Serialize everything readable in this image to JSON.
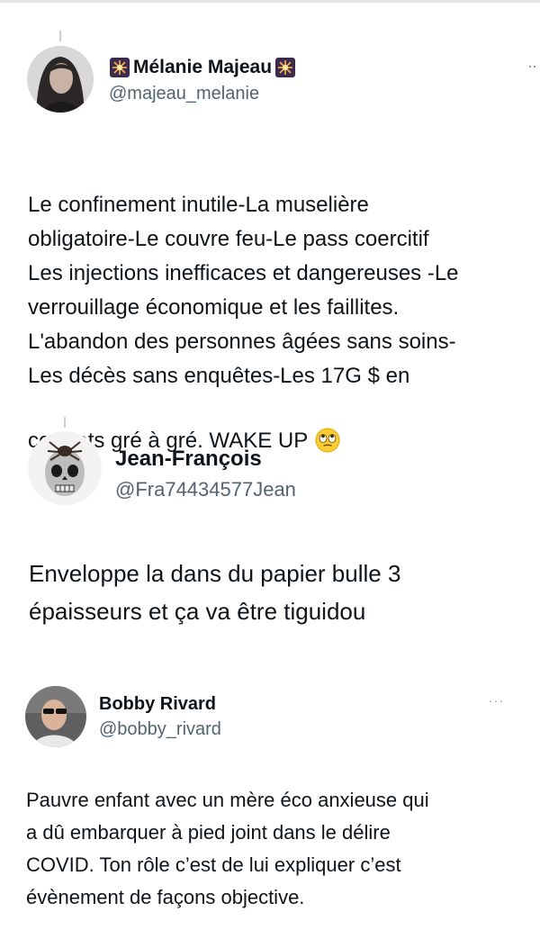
{
  "tweets": [
    {
      "name": "Mélanie Majeau",
      "handle": "@majeau_melanie",
      "name_emoji_icon": "sparkle-burst-emoji",
      "more_icon": "more-dots-icon",
      "text": "Le confinement inutile-La muselière\nobligatoire-Le couvre feu-Le pass coercitif\nLes injections inefficaces et dangereuses -Le\nverrouillage économique et les faillites.\nL'abandon des personnes âgées sans soins-\nLes décès sans enquêtes-Les 17G $ en\ncontrats gré à gré. WAKE UP",
      "trailing_emoji_icon": "eye-roll-emoji"
    },
    {
      "name": "Jean-François",
      "handle": "@Fra74434577Jean",
      "text": "Enveloppe la dans du papier bulle 3\népaisseurs et ça va être tiguidou"
    },
    {
      "name": "Bobby Rivard",
      "handle": "@bobby_rivard",
      "more_icon": "more-dots-icon",
      "more_label": "···",
      "text": "Pauvre enfant avec un mère éco anxieuse qui\na dû embarquer à pied joint dans le délire\nCOVID. Ton rôle c’est de lui expliquer c’est\névènement de façons objective."
    }
  ],
  "colors": {
    "text": "#0f1419",
    "secondary": "#536471",
    "thread_line": "#c9ced3"
  }
}
